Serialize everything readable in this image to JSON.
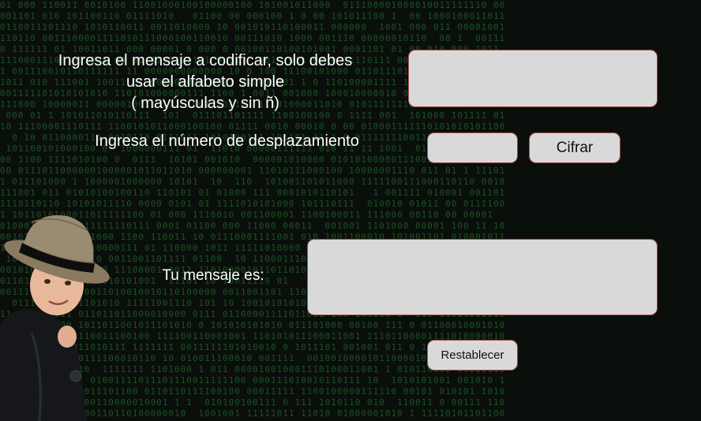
{
  "form": {
    "message_prompt": "Ingresa el mensaje a codificar,  solo debes\nusar el alfabeto simple\n( mayúsculas y sin ñ)",
    "shift_prompt": "Ingresa el número de desplazamiento",
    "message_value": "",
    "shift_value": "",
    "encrypt_label": "Cifrar"
  },
  "result": {
    "label": "Tu mensaje es:",
    "value": "",
    "reset_label": "Restablecer"
  },
  "illustration": {
    "icon": "boy-in-fedora-figure"
  },
  "colors": {
    "background": "#0a0f0b",
    "matrix_text": "#1f5e27",
    "field_fill": "#d9d9d9",
    "field_border": "#a14a4a",
    "label_text": "#ffffff"
  }
}
